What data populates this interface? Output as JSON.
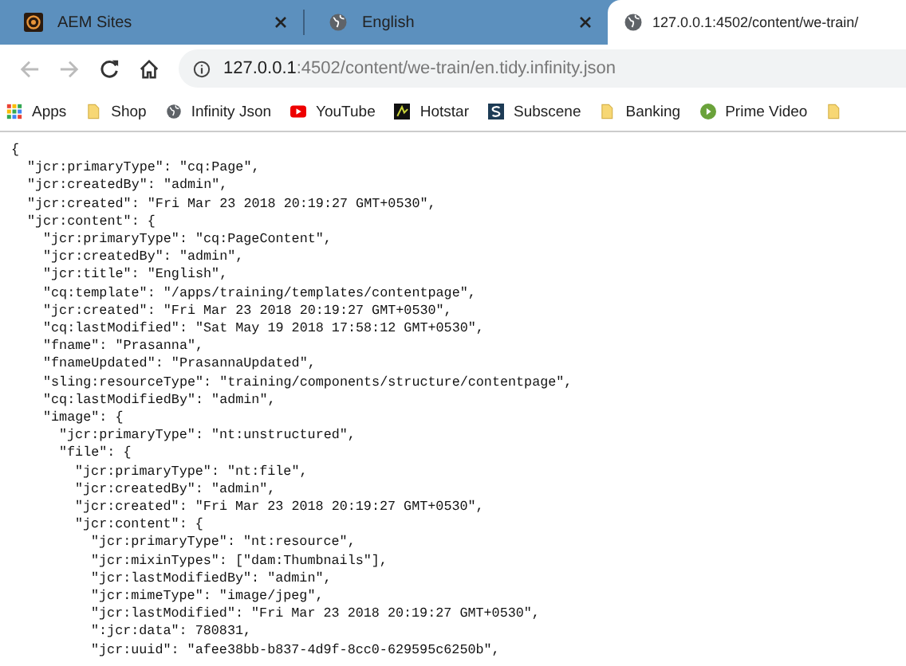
{
  "tabs": [
    {
      "title": "AEM Sites",
      "kind": "aem",
      "selected": false
    },
    {
      "title": "English",
      "kind": "globe",
      "selected": false
    },
    {
      "title": "127.0.0.1:4502/content/we-train/",
      "kind": "globe",
      "selected": true
    }
  ],
  "address": {
    "host": "127.0.0.1",
    "path": ":4502/content/we-train/en.tidy.infinity.json"
  },
  "bookmarks": [
    {
      "label": "Apps",
      "kind": "apps"
    },
    {
      "label": "Shop",
      "kind": "folder"
    },
    {
      "label": "Infinity Json",
      "kind": "globe"
    },
    {
      "label": "YouTube",
      "kind": "youtube"
    },
    {
      "label": "Hotstar",
      "kind": "hotstar"
    },
    {
      "label": "Subscene",
      "kind": "subscene"
    },
    {
      "label": "Banking",
      "kind": "folder"
    },
    {
      "label": "Prime Video",
      "kind": "play"
    },
    {
      "kind": "folder"
    }
  ],
  "json_lines": [
    {
      "text": "{",
      "children": [
        {
          "text": "\"jcr:primaryType\": \"cq:Page\","
        },
        {
          "text": "\"jcr:createdBy\": \"admin\","
        },
        {
          "text": "\"jcr:created\": \"Fri Mar 23 2018 20:19:27 GMT+0530\","
        },
        {
          "text": "\"jcr:content\": {",
          "children": [
            {
              "text": "\"jcr:primaryType\": \"cq:PageContent\","
            },
            {
              "text": "\"jcr:createdBy\": \"admin\","
            },
            {
              "text": "\"jcr:title\": \"English\","
            },
            {
              "text": "\"cq:template\": \"/apps/training/templates/contentpage\","
            },
            {
              "text": "\"jcr:created\": \"Fri Mar 23 2018 20:19:27 GMT+0530\","
            },
            {
              "text": "\"cq:lastModified\": \"Sat May 19 2018 17:58:12 GMT+0530\","
            },
            {
              "text": "\"fname\": \"Prasanna\","
            },
            {
              "text": "\"fnameUpdated\": \"PrasannaUpdated\","
            },
            {
              "text": "\"sling:resourceType\": \"training/components/structure/contentpage\","
            },
            {
              "text": "\"cq:lastModifiedBy\": \"admin\","
            },
            {
              "text": "\"image\": {",
              "children": [
                {
                  "text": "\"jcr:primaryType\": \"nt:unstructured\","
                },
                {
                  "text": "\"file\": {",
                  "children": [
                    {
                      "text": "\"jcr:primaryType\": \"nt:file\","
                    },
                    {
                      "text": "\"jcr:createdBy\": \"admin\","
                    },
                    {
                      "text": "\"jcr:created\": \"Fri Mar 23 2018 20:19:27 GMT+0530\","
                    },
                    {
                      "text": "\"jcr:content\": {",
                      "children": [
                        {
                          "text": "\"jcr:primaryType\": \"nt:resource\","
                        },
                        {
                          "text": "\"jcr:mixinTypes\": [\"dam:Thumbnails\"],"
                        },
                        {
                          "text": "\"jcr:lastModifiedBy\": \"admin\","
                        },
                        {
                          "text": "\"jcr:mimeType\": \"image/jpeg\","
                        },
                        {
                          "text": "\"jcr:lastModified\": \"Fri Mar 23 2018 20:19:27 GMT+0530\","
                        },
                        {
                          "text": "\":jcr:data\": 780831,"
                        },
                        {
                          "text": "\"jcr:uuid\": \"afee38bb-b837-4d9f-8cc0-629595c6250b\","
                        }
                      ]
                    }
                  ]
                }
              ]
            }
          ]
        }
      ]
    }
  ]
}
